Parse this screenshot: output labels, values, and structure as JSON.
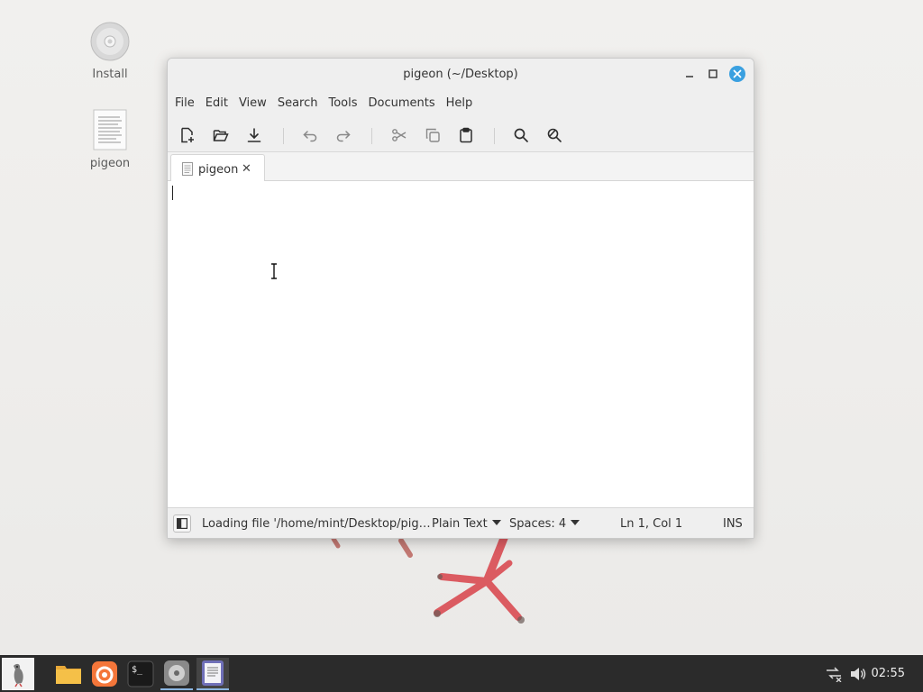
{
  "desktop": {
    "icons": [
      {
        "label": "Install",
        "icon": "disc-icon"
      },
      {
        "label": "pigeon",
        "icon": "text-file-icon"
      }
    ]
  },
  "window": {
    "title": "pigeon (~/Desktop)",
    "menu": [
      "File",
      "Edit",
      "View",
      "Search",
      "Tools",
      "Documents",
      "Help"
    ],
    "toolbar": [
      "new-document",
      "open",
      "save",
      "undo",
      "redo",
      "cut",
      "copy",
      "paste",
      "find",
      "find-replace"
    ],
    "tab": {
      "label": "pigeon",
      "close": "✕"
    },
    "editor": {
      "content": ""
    },
    "status": {
      "message": "Loading file '/home/mint/Desktop/pig…",
      "language": "Plain Text",
      "indent": "Spaces: 4",
      "position": "Ln 1, Col 1",
      "mode": "INS"
    }
  },
  "taskbar": {
    "apps": [
      "menu",
      "files",
      "firefox",
      "terminal",
      "disk-manager",
      "text-editor"
    ],
    "clock": "02:55"
  },
  "colors": {
    "close_button": "#3aa0e0",
    "taskbar": "#2b2b2b",
    "active_indicator": "#8ab4e0"
  }
}
